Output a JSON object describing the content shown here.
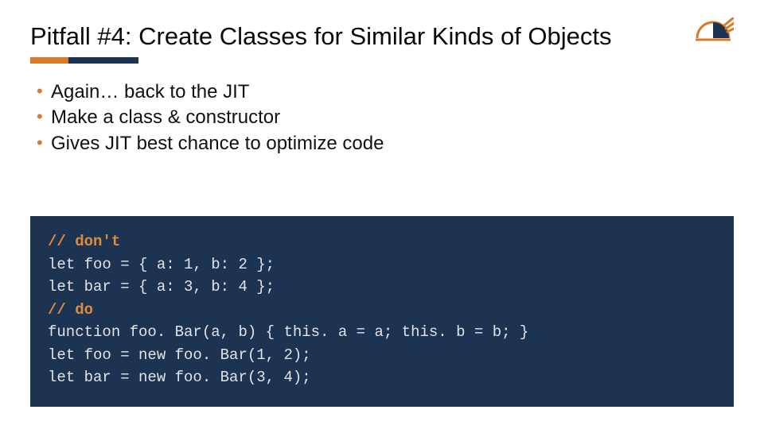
{
  "title": "Pitfall #4: Create Classes for Similar Kinds of Objects",
  "bullets": [
    "Again… back to the JIT",
    "Make a class & constructor",
    "Gives JIT best chance to optimize code"
  ],
  "code": {
    "lines": [
      {
        "text": "// don't",
        "cls": "code-comment"
      },
      {
        "text": "let foo = { a: 1, b: 2 };",
        "cls": ""
      },
      {
        "text": "let bar = { a: 3, b: 4 };",
        "cls": ""
      },
      {
        "text": "// do",
        "cls": "code-comment"
      },
      {
        "text": "function foo. Bar(a, b) { this. a = a; this. b = b; }",
        "cls": ""
      },
      {
        "text": "let foo = new foo. Bar(1, 2);",
        "cls": ""
      },
      {
        "text": "let bar = new foo. Bar(3, 4);",
        "cls": ""
      }
    ]
  },
  "colors": {
    "accent_orange": "#d97a2b",
    "accent_navy": "#1d3352"
  }
}
